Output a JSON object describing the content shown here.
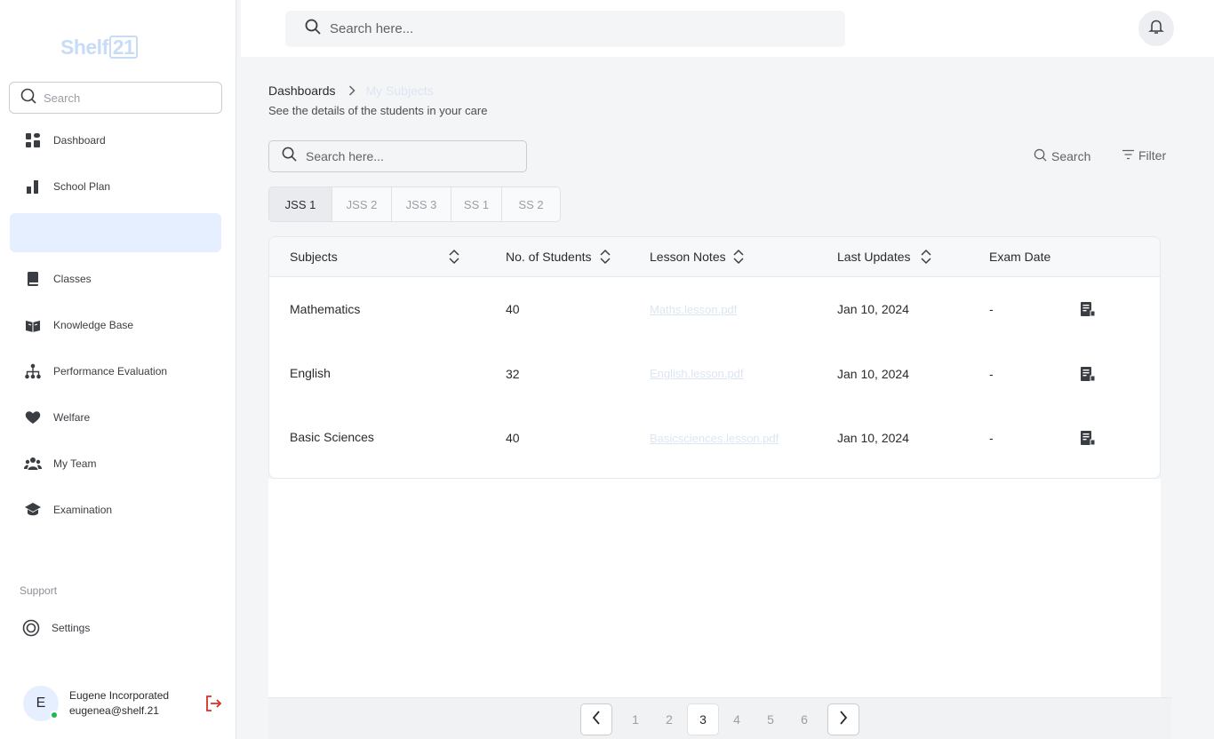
{
  "brand": {
    "logo_text": "Shelf",
    "logo_number": "21"
  },
  "sidebar": {
    "search_placeholder": "Search",
    "items": [
      {
        "label": "Dashboard",
        "icon": "grid-icon"
      },
      {
        "label": "School Plan",
        "icon": "bar-chart-icon"
      },
      {
        "label": "",
        "icon": ""
      },
      {
        "label": "Classes",
        "icon": "book-icon"
      },
      {
        "label": "Knowledge Base",
        "icon": "open-book-icon"
      },
      {
        "label": "Performance Evaluation",
        "icon": "hierarchy-icon"
      },
      {
        "label": "Welfare",
        "icon": "heart-icon"
      },
      {
        "label": "My Team",
        "icon": "team-icon"
      },
      {
        "label": "Examination",
        "icon": "graduation-cap-icon"
      }
    ],
    "support_label": "Support",
    "settings_label": "Settings",
    "user": {
      "initial": "E",
      "name": "Eugene Incorporated",
      "email": "eugenea@shelf.21"
    }
  },
  "topbar": {
    "search_placeholder": "Search here..."
  },
  "breadcrumb": {
    "root": "Dashboards",
    "current": "My Subjects"
  },
  "subtitle": "See the details of the students in your care",
  "toolbar": {
    "search_placeholder": "Search here...",
    "search_label": "Search",
    "filter_label": "Filter"
  },
  "tabs": [
    "JSS 1",
    "JSS 2",
    "JSS 3",
    "SS 1",
    "SS 2"
  ],
  "table": {
    "headers": {
      "subjects": "Subjects",
      "students": "No. of Students",
      "notes": "Lesson Notes",
      "updated": "Last Updates",
      "exam": "Exam Date"
    },
    "rows": [
      {
        "subject": "Mathematics",
        "students": "40",
        "notes": "Maths.lesson.pdf",
        "updated": "Jan 10, 2024",
        "exam": "-"
      },
      {
        "subject": "English",
        "students": "32",
        "notes": "English.lesson.pdf",
        "updated": "Jan 10, 2024",
        "exam": "-"
      },
      {
        "subject": "Basic Sciences",
        "students": "40",
        "notes": "Basicsciences.lesson.pdf",
        "updated": "Jan 10, 2024",
        "exam": "-"
      }
    ]
  },
  "pagination": {
    "pages": [
      "1",
      "2",
      "3",
      "4",
      "5",
      "6"
    ],
    "current": "3"
  },
  "colors": {
    "active_nav_bg": "#e6efff",
    "online_dot": "#1db954",
    "logout": "#d93025",
    "logo": "#c8dcf5"
  }
}
